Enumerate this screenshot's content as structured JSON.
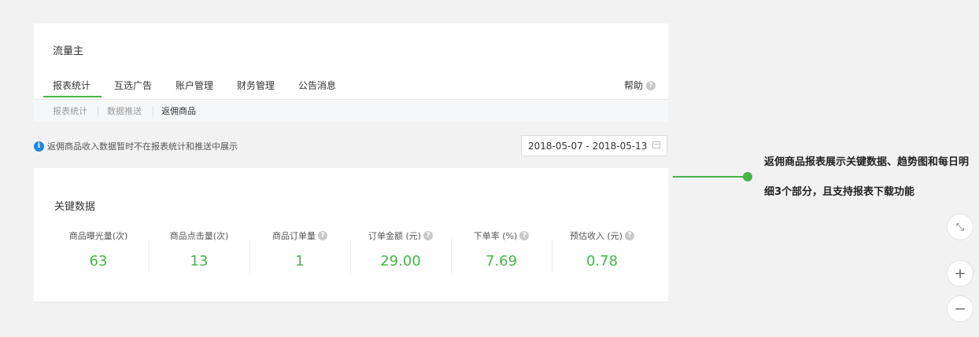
{
  "app": {
    "brand": "流量主"
  },
  "tabs": [
    {
      "label": "报表统计"
    },
    {
      "label": "互选广告"
    },
    {
      "label": "账户管理"
    },
    {
      "label": "财务管理"
    },
    {
      "label": "公告消息"
    }
  ],
  "help": {
    "label": "帮助"
  },
  "subnav": [
    {
      "label": "报表统计"
    },
    {
      "label": "数据推送"
    },
    {
      "label": "返佣商品"
    }
  ],
  "notice": {
    "text": "返佣商品收入数据暂时不在报表统计和推送中展示"
  },
  "date_range": {
    "value": "2018-05-07 - 2018-05-13"
  },
  "key_data": {
    "title": "关键数据",
    "stats": [
      {
        "label": "商品曝光量(次)",
        "value": "63",
        "help": false
      },
      {
        "label": "商品点击量(次)",
        "value": "13",
        "help": false
      },
      {
        "label": "商品订单量",
        "value": "1",
        "help": true
      },
      {
        "label": "订单金额 (元)",
        "value": "29.00",
        "help": true
      },
      {
        "label": "下单率 (%)",
        "value": "7.69",
        "help": true
      },
      {
        "label": "预估收入 (元)",
        "value": "0.78",
        "help": true
      }
    ]
  },
  "annotation": {
    "text": "返佣商品报表展示关键数据、趋势图和每日明细3个部分，且支持报表下载功能"
  },
  "controls": {
    "shrink": "⤡",
    "zoom_in": "+",
    "zoom_out": "−"
  },
  "colors": {
    "accent": "#44b549",
    "info": "#1e88e5"
  }
}
